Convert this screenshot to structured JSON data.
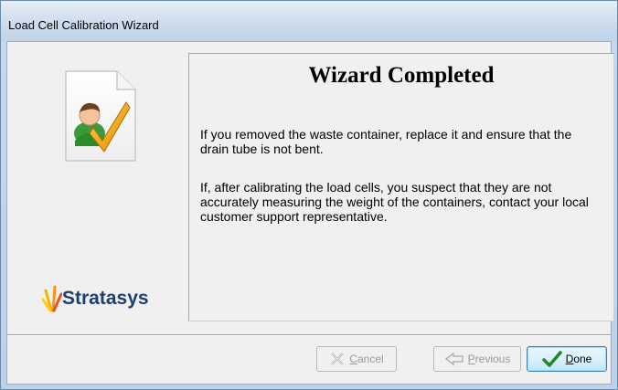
{
  "window": {
    "title": "Load Cell Calibration Wizard"
  },
  "left_pane": {
    "logo_text": "Stratasys",
    "icon": "document-user-check-icon"
  },
  "panel": {
    "heading": "Wizard Completed",
    "paragraph1": "If you removed the waste container, replace it and ensure that the drain tube is not bent.",
    "paragraph2": "If, after calibrating the load cells, you suspect that they are not accurately measuring the weight of the containers, contact your local customer support representative."
  },
  "buttons": {
    "cancel": {
      "mnemonic": "C",
      "rest": "ancel",
      "enabled": false
    },
    "previous": {
      "mnemonic": "P",
      "rest": "revious",
      "enabled": false
    },
    "done": {
      "mnemonic": "D",
      "rest": "one",
      "enabled": true
    }
  },
  "colors": {
    "logo_text": "#1b3f73",
    "done_border": "#3c7fb1",
    "check_green": "#1d8a1d"
  }
}
